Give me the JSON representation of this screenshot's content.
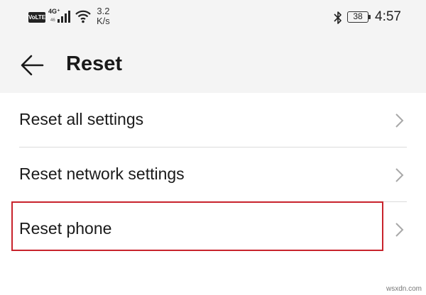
{
  "status_bar": {
    "volte": "VoLTE",
    "network_type": "4G⁺",
    "network_sub": "46",
    "speed_value": "3.2",
    "speed_unit": "K/s",
    "battery": "38",
    "time": "4:57"
  },
  "app_bar": {
    "title": "Reset",
    "back_icon": "back-arrow-icon"
  },
  "items": [
    {
      "label": "Reset all settings",
      "icon": "chevron-right-icon"
    },
    {
      "label": "Reset network settings",
      "icon": "chevron-right-icon"
    },
    {
      "label": "Reset phone",
      "icon": "chevron-right-icon"
    }
  ],
  "colors": {
    "header_background": "#f4f4f4",
    "highlight": "#c8232c",
    "divider": "#dcdcdc"
  },
  "watermark": "wsxdn.com"
}
